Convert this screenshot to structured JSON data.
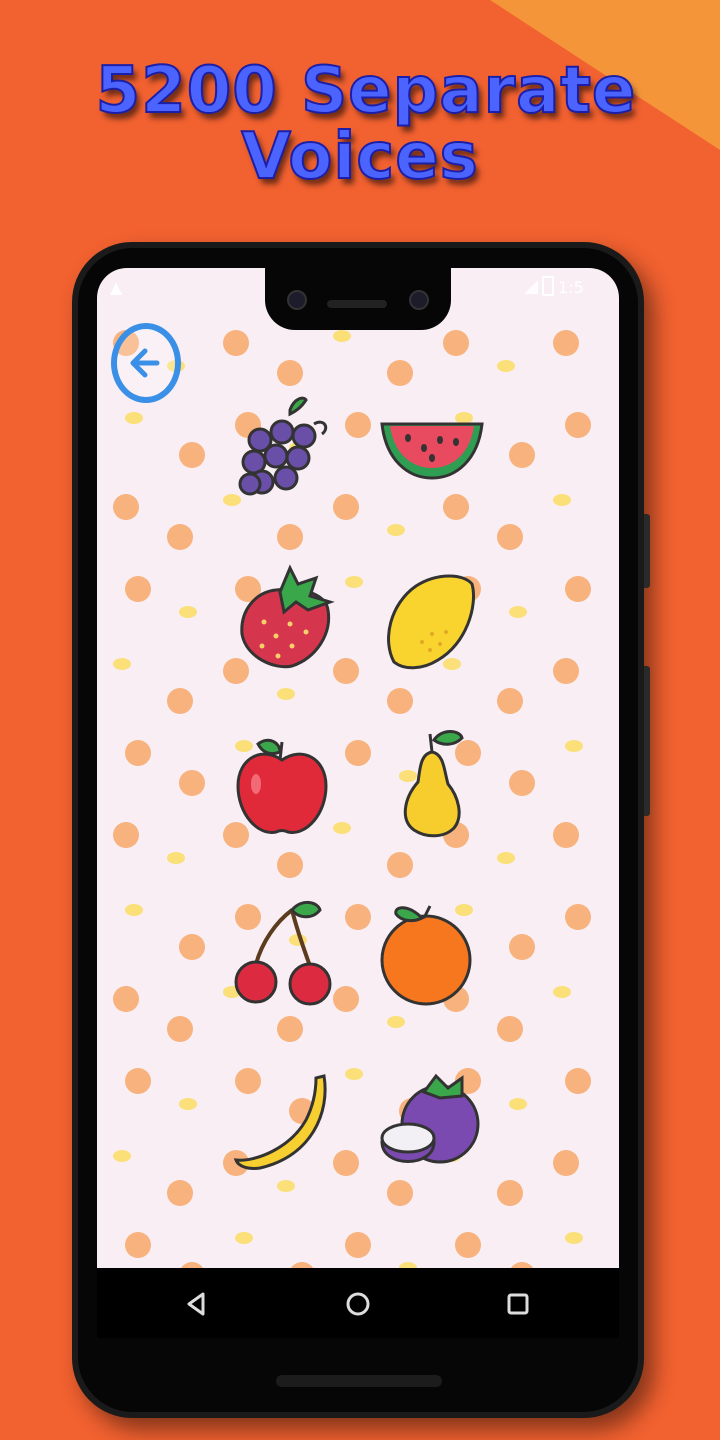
{
  "promo": {
    "line1": "5200 Separate",
    "line2": "Voices"
  },
  "status_bar": {
    "time": "1:5"
  },
  "back_button": {
    "icon": "arrow-left-icon",
    "color": "#3a8fe6"
  },
  "fruits": [
    {
      "name": "grapes"
    },
    {
      "name": "watermelon"
    },
    {
      "name": "strawberry"
    },
    {
      "name": "lemon"
    },
    {
      "name": "apple"
    },
    {
      "name": "pear"
    },
    {
      "name": "cherries"
    },
    {
      "name": "orange"
    },
    {
      "name": "banana"
    },
    {
      "name": "mangosteen"
    }
  ],
  "nav": {
    "back": "back-triangle-icon",
    "home": "home-circle-icon",
    "recents": "recents-square-icon"
  },
  "colors": {
    "background": "#f26130",
    "accent": "#f4953a",
    "title_fill": "#4b63ff",
    "screen_bg": "#f8eef3"
  }
}
